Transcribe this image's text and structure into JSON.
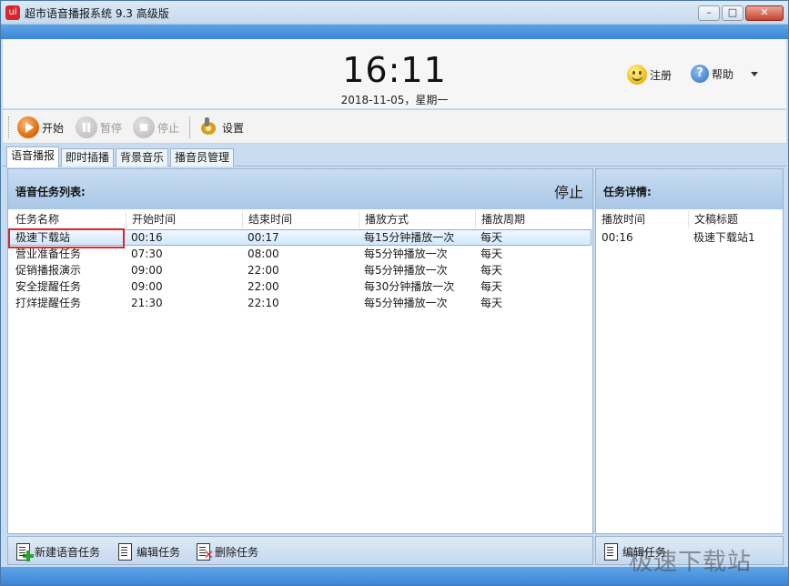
{
  "window": {
    "title": "超市语音播报系统 9.3 高级版",
    "icon_text": "ul",
    "minimize": "–",
    "maximize": "□",
    "close": "✕"
  },
  "header": {
    "time": "16:11",
    "date": "2018-11-05，星期一",
    "register_label": "注册",
    "help_label": "帮助"
  },
  "toolbar": {
    "start_label": "开始",
    "pause_label": "暂停",
    "stop_label": "停止",
    "settings_label": "设置"
  },
  "tabs": [
    "语音播报",
    "即时插播",
    "背景音乐",
    "播音员管理"
  ],
  "task_list": {
    "title": "语音任务列表:",
    "status": "停止",
    "columns": [
      "任务名称",
      "开始时间",
      "结束时间",
      "播放方式",
      "播放周期"
    ],
    "rows": [
      {
        "name": "极速下载站",
        "start": "00:16",
        "end": "00:17",
        "mode": "每15分钟播放一次",
        "cycle": "每天"
      },
      {
        "name": "营业准备任务",
        "start": "07:30",
        "end": "08:00",
        "mode": "每5分钟播放一次",
        "cycle": "每天"
      },
      {
        "name": "促销播报演示",
        "start": "09:00",
        "end": "22:00",
        "mode": "每5分钟播放一次",
        "cycle": "每天"
      },
      {
        "name": "安全提醒任务",
        "start": "09:00",
        "end": "22:00",
        "mode": "每30分钟播放一次",
        "cycle": "每天"
      },
      {
        "name": "打烊提醒任务",
        "start": "21:30",
        "end": "22:10",
        "mode": "每5分钟播放一次",
        "cycle": "每天"
      }
    ]
  },
  "task_detail": {
    "title": "任务详情:",
    "columns": [
      "播放时间",
      "文稿标题"
    ],
    "rows": [
      {
        "time": "00:16",
        "title": "极速下载站1"
      }
    ]
  },
  "bottom_left": {
    "new_label": "新建语音任务",
    "edit_label": "编辑任务",
    "delete_label": "删除任务"
  },
  "bottom_right": {
    "edit_label": "编辑任务"
  },
  "watermark": "极速下载站",
  "colors": {
    "accent_blue": "#3b86d6",
    "selection_border": "#7fb0e6",
    "highlight_red": "#d9272e"
  }
}
